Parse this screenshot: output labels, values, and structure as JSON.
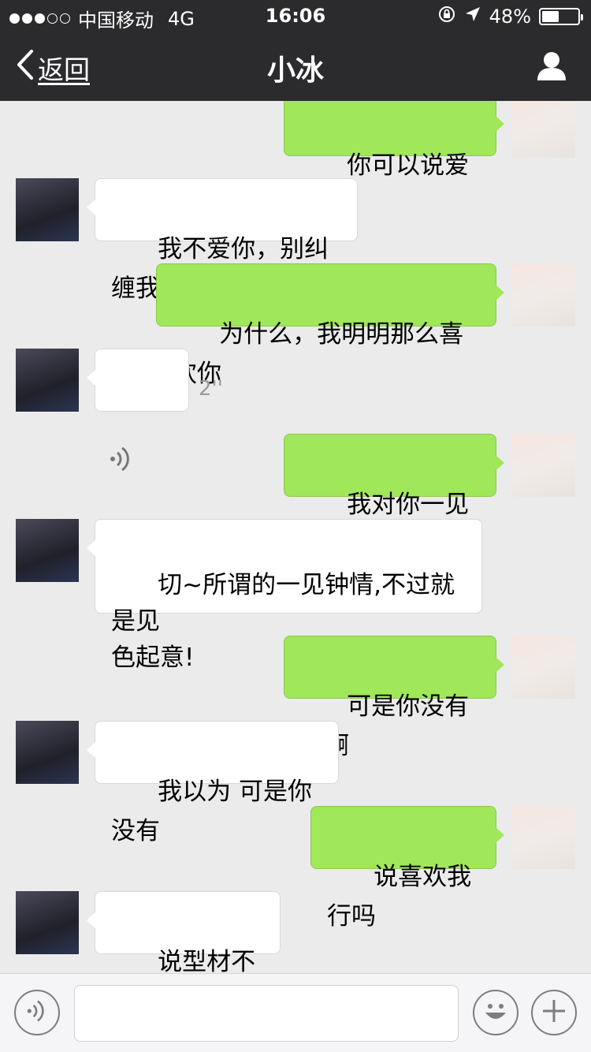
{
  "status_bar": {
    "carrier": "中国移动",
    "network": "4G",
    "time": "16:06",
    "battery": "48%",
    "battery_level": 0.48
  },
  "nav": {
    "back_label": "返回",
    "title": "小冰"
  },
  "messages": [
    {
      "sender": "me",
      "text": "你可以说爱我吗"
    },
    {
      "sender": "her",
      "text": "我不爱你，别纠缠我"
    },
    {
      "sender": "me",
      "text": "为什么，我明明那么喜欢你"
    },
    {
      "sender": "her",
      "type": "voice",
      "duration": "2''"
    },
    {
      "sender": "me",
      "text": "我对你一见钟情"
    },
    {
      "sender": "her",
      "text": "切~所谓的一见钟情,不过就是见\n色起意!"
    },
    {
      "sender": "me",
      "text": "可是你没有色啊"
    },
    {
      "sender": "her",
      "text": "我以为 可是你没有"
    },
    {
      "sender": "me",
      "text": "说喜欢我行吗"
    },
    {
      "sender": "her",
      "text": "说型材不行!"
    }
  ],
  "colors": {
    "nav_bg": "#2b2b2d",
    "chat_bg": "#ebebeb",
    "my_bubble": "#a0e75a",
    "her_bubble": "#ffffff"
  },
  "icons": [
    "back-chevron-icon",
    "person-icon",
    "voice-icon",
    "emoji-icon",
    "plus-icon",
    "location-arrow-icon",
    "lock-rotation-icon"
  ]
}
